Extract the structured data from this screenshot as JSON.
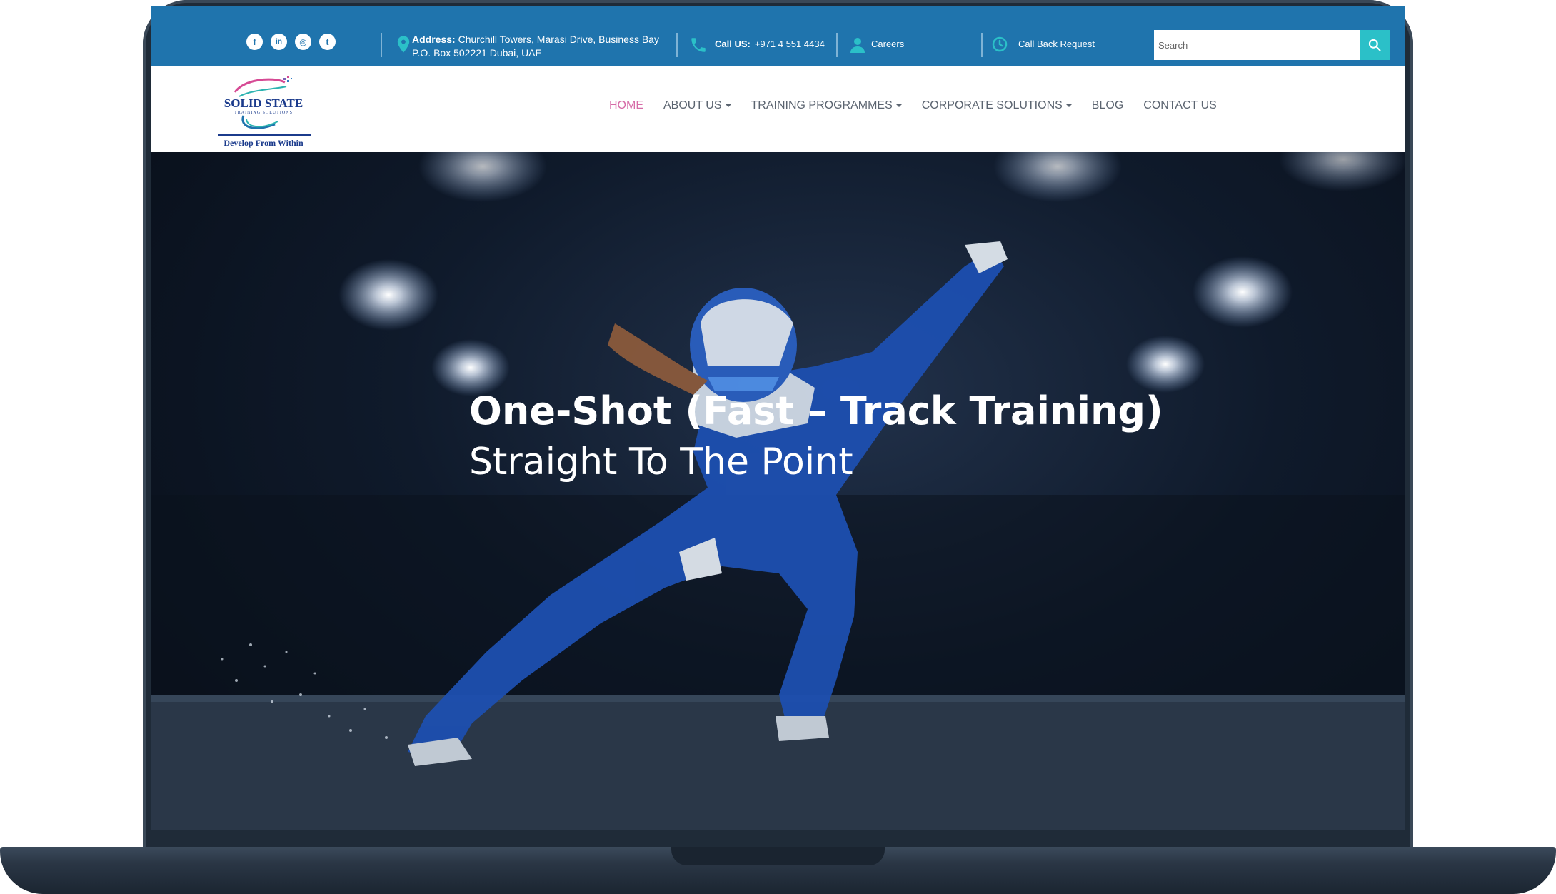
{
  "topbar": {
    "social": [
      {
        "name": "facebook",
        "glyph": "f"
      },
      {
        "name": "linkedin",
        "glyph": "in"
      },
      {
        "name": "instagram",
        "glyph": "◎"
      },
      {
        "name": "twitter",
        "glyph": "t"
      }
    ],
    "address_label": "Address:",
    "address_line1": "Churchill Towers, Marasi Drive, Business Bay",
    "address_line2": "P.O. Box 502221 Dubai, UAE",
    "call_label": "Call US:",
    "call_number": "+971 4 551 4434",
    "careers": "Careers",
    "callback": "Call Back Request",
    "search_placeholder": "Search"
  },
  "logo": {
    "name": "SOLID STATE",
    "sub": "TRAINING SOLUTIONS",
    "tagline": "Develop From Within"
  },
  "nav": {
    "items": [
      {
        "label": "HOME",
        "active": true,
        "dropdown": false
      },
      {
        "label": "ABOUT US",
        "active": false,
        "dropdown": true
      },
      {
        "label": "TRAINING PROGRAMMES",
        "active": false,
        "dropdown": true
      },
      {
        "label": "CORPORATE SOLUTIONS",
        "active": false,
        "dropdown": true
      },
      {
        "label": "BLOG",
        "active": false,
        "dropdown": false
      },
      {
        "label": "CONTACT US",
        "active": false,
        "dropdown": false
      }
    ]
  },
  "hero": {
    "title": "One-Shot (Fast – Track Training)",
    "subtitle": "Straight To The Point"
  },
  "colors": {
    "topbar": "#1f74ad",
    "search_button": "#2bc0c8",
    "nav_active": "#d66ba7",
    "logo_blue": "#1b3b8c"
  }
}
